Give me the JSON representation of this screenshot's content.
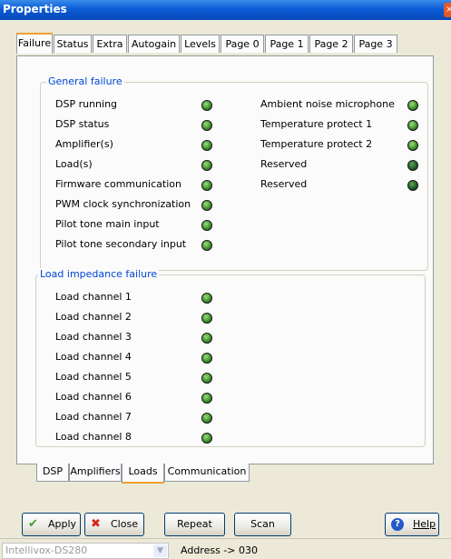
{
  "window": {
    "title": "Properties",
    "close_glyph": "×"
  },
  "top_tabs": [
    "Failure",
    "Status",
    "Extra",
    "Autogain",
    "Levels",
    "Page 0",
    "Page 1",
    "Page 2",
    "Page 3"
  ],
  "active_top_tab": "Failure",
  "general_failure": {
    "label": "General failure",
    "left_items": [
      "DSP running",
      "DSP status",
      "Amplifier(s)",
      "Load(s)",
      "Firmware communication",
      "PWM clock synchronization",
      "Pilot tone main input",
      "Pilot tone secondary input"
    ],
    "right_items": [
      "Ambient noise microphone",
      "Temperature protect 1",
      "Temperature protect 2",
      "Reserved",
      "Reserved"
    ]
  },
  "load_impedance": {
    "label": "Load impedance failure",
    "items": [
      "Load channel 1",
      "Load channel 2",
      "Load channel 3",
      "Load channel 4",
      "Load channel 5",
      "Load channel 6",
      "Load channel 7",
      "Load channel 8"
    ]
  },
  "bottom_tabs": [
    "DSP",
    "Amplifiers",
    "Loads",
    "Communication"
  ],
  "active_bottom_tab": "Loads",
  "buttons": {
    "apply": "Apply",
    "close": "Close",
    "repeat": "Repeat",
    "scan": "Scan",
    "help": "Help"
  },
  "status": {
    "device": "Intellivox-DS280",
    "address": "Address -> 030"
  },
  "colors": {
    "titlebar": "#0a5bd6",
    "group_label": "#0046d5",
    "led_green": "#3b8a2a",
    "active_tab_accent": "#f0a030"
  }
}
